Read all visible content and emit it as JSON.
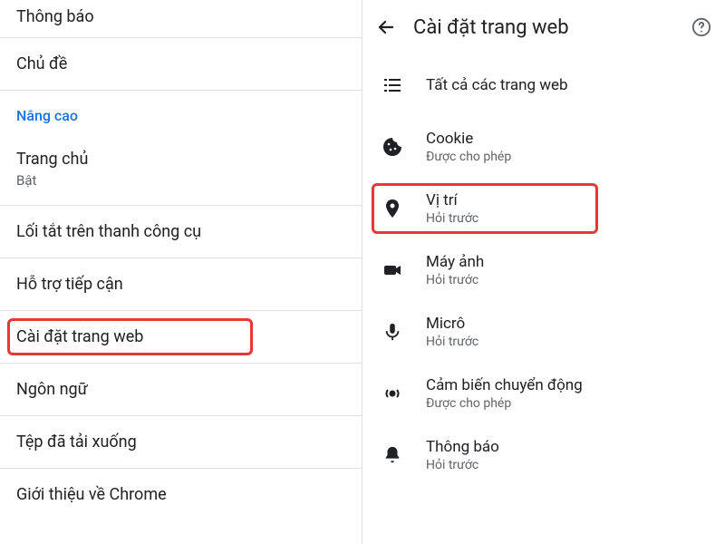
{
  "left": {
    "items": [
      {
        "title": "Thông báo",
        "sub": "",
        "kind": "row"
      },
      {
        "title": "Chủ đề",
        "sub": "",
        "kind": "row"
      },
      {
        "title": "Nâng cao",
        "kind": "section"
      },
      {
        "title": "Trang chủ",
        "sub": "Bật",
        "kind": "row"
      },
      {
        "title": "Lối tắt trên thanh công cụ",
        "sub": "",
        "kind": "row"
      },
      {
        "title": "Hỗ trợ tiếp cận",
        "sub": "",
        "kind": "row"
      },
      {
        "title": "Cài đặt trang web",
        "sub": "",
        "kind": "row",
        "highlight": true
      },
      {
        "title": "Ngôn ngữ",
        "sub": "",
        "kind": "row"
      },
      {
        "title": "Tệp đã tải xuống",
        "sub": "",
        "kind": "row"
      },
      {
        "title": "Giới thiệu về Chrome",
        "sub": "",
        "kind": "row"
      }
    ]
  },
  "right": {
    "title": "Cài đặt trang web",
    "items": [
      {
        "icon": "list",
        "title": "Tất cả các trang web",
        "sub": ""
      },
      {
        "icon": "cookie",
        "title": "Cookie",
        "sub": "Được cho phép"
      },
      {
        "icon": "location",
        "title": "Vị trí",
        "sub": "Hỏi trước",
        "highlight": true
      },
      {
        "icon": "camera",
        "title": "Máy ảnh",
        "sub": "Hỏi trước"
      },
      {
        "icon": "mic",
        "title": "Micrô",
        "sub": "Hỏi trước"
      },
      {
        "icon": "sensor",
        "title": "Cảm biến chuyển động",
        "sub": "Được cho phép"
      },
      {
        "icon": "bell",
        "title": "Thông báo",
        "sub": "Hỏi trước"
      }
    ]
  }
}
